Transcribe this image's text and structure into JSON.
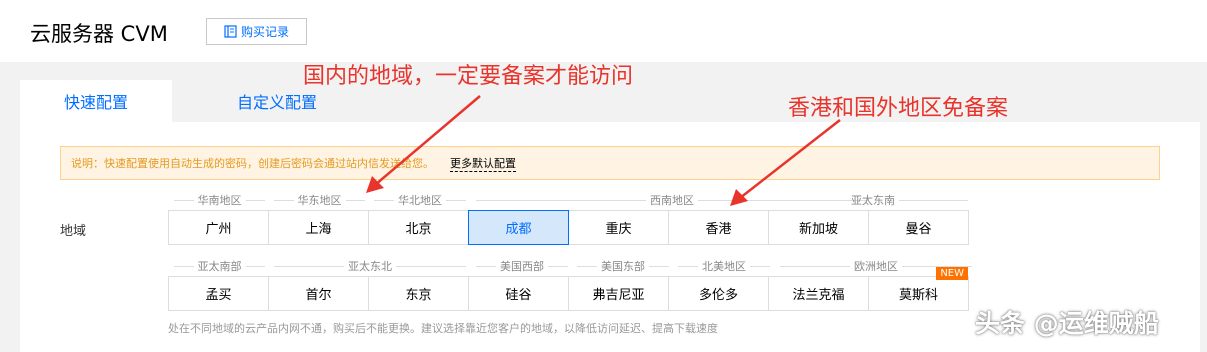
{
  "header": {
    "title": "云服务器 CVM",
    "purchase_history": "购买记录"
  },
  "tabs": [
    {
      "label": "快速配置",
      "active": true
    },
    {
      "label": "自定义配置",
      "active": false
    }
  ],
  "notice": {
    "text": "说明：快速配置使用自动生成的密码，创建后密码会通过站内信发送给您。",
    "link": "更多默认配置"
  },
  "region": {
    "label": "地域",
    "row1_groups": [
      "华南地区",
      "华东地区",
      "华北地区",
      "西南地区",
      "亚太东南"
    ],
    "row1": [
      {
        "name": "广州",
        "selected": false
      },
      {
        "name": "上海",
        "selected": false
      },
      {
        "name": "北京",
        "selected": false
      },
      {
        "name": "成都",
        "selected": true
      },
      {
        "name": "重庆",
        "selected": false
      },
      {
        "name": "香港",
        "selected": false
      },
      {
        "name": "新加坡",
        "selected": false
      },
      {
        "name": "曼谷",
        "selected": false
      }
    ],
    "row2_groups": [
      "亚太南部",
      "亚太东北",
      "美国西部",
      "美国东部",
      "北美地区",
      "欧洲地区"
    ],
    "row2": [
      {
        "name": "孟买"
      },
      {
        "name": "首尔"
      },
      {
        "name": "东京"
      },
      {
        "name": "硅谷"
      },
      {
        "name": "弗吉尼亚"
      },
      {
        "name": "多伦多"
      },
      {
        "name": "法兰克福"
      },
      {
        "name": "莫斯科",
        "badge": "NEW"
      }
    ],
    "hint": "处在不同地域的云产品内网不通，购买后不能更换。建议选择靠近您客户的地域，以降低访问延迟、提高下载速度"
  },
  "annotations": {
    "domestic": "国内的地域，一定要备案才能访问",
    "overseas": "香港和国外地区免备案"
  },
  "watermark": "头条 @运维贼船",
  "colors": {
    "accent": "#006eff",
    "annotation": "#e8342b",
    "notice_bg": "#fff4e3",
    "badge": "#ff7200"
  }
}
